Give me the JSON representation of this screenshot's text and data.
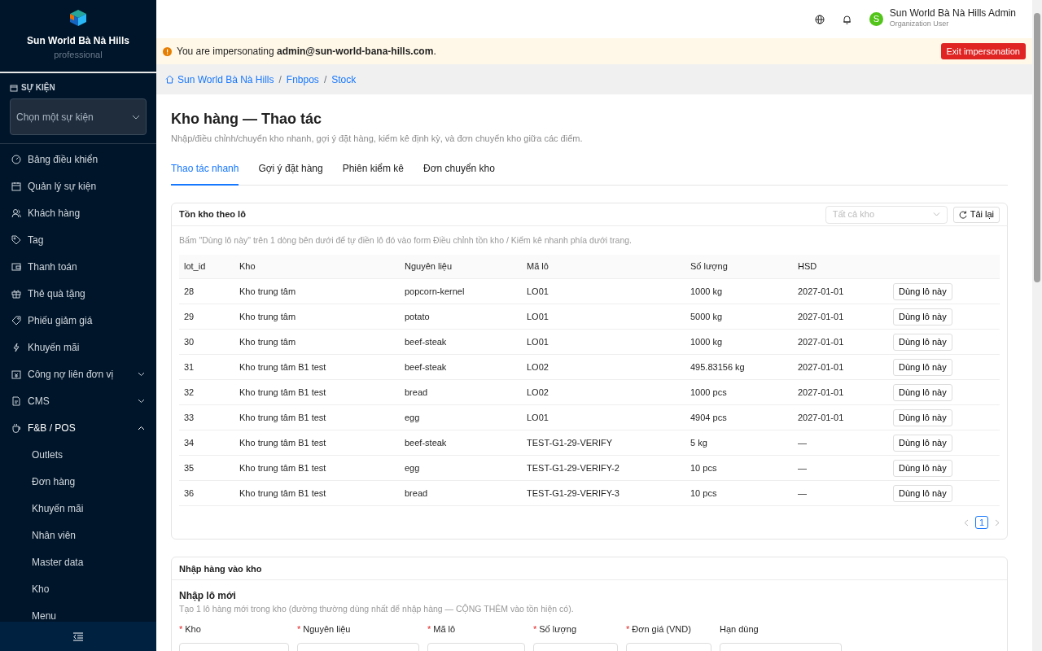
{
  "brand": {
    "name": "Sun World Bà Nà Hills",
    "plan": "professional"
  },
  "event_picker": {
    "label": "SỰ KIỆN",
    "placeholder": "Chọn một sự kiện"
  },
  "sidebar": {
    "items": [
      {
        "label": "Bảng điều khiển"
      },
      {
        "label": "Quản lý sự kiện"
      },
      {
        "label": "Khách hàng"
      },
      {
        "label": "Tag"
      },
      {
        "label": "Thanh toán"
      },
      {
        "label": "Thẻ quà tặng"
      },
      {
        "label": "Phiếu giảm giá"
      },
      {
        "label": "Khuyến mãi"
      },
      {
        "label": "Công nợ liên đơn vị",
        "expanded": false
      },
      {
        "label": "CMS",
        "expanded": false
      },
      {
        "label": "F&B / POS",
        "expanded": true,
        "children": [
          {
            "label": "Outlets"
          },
          {
            "label": "Đơn hàng"
          },
          {
            "label": "Khuyến mãi"
          },
          {
            "label": "Nhân viên"
          },
          {
            "label": "Master data"
          },
          {
            "label": "Kho"
          },
          {
            "label": "Menu"
          }
        ]
      }
    ]
  },
  "user": {
    "initial": "S",
    "name": "Sun World Bà Nà Hills Admin",
    "role": "Organization User"
  },
  "impersonation": {
    "text": "You are impersonating **admin@sun-world-bana-hills.com**.",
    "button": "Exit impersonation"
  },
  "breadcrumb": {
    "items": [
      "Sun World Bà Nà Hills",
      "Fnbpos",
      "Stock"
    ],
    "separator": "/"
  },
  "page": {
    "title": "Kho hàng — Thao tác",
    "subtitle": "Nhập/điều chỉnh/chuyển kho nhanh, gợi ý đặt hàng, kiểm kê định kỳ, và đơn chuyển kho giữa các điểm."
  },
  "tabs": [
    {
      "label": "Thao tác nhanh",
      "selected": true
    },
    {
      "label": "Gợi ý đặt hàng",
      "selected": false
    },
    {
      "label": "Phiên kiểm kê",
      "selected": false
    },
    {
      "label": "Đơn chuyển kho",
      "selected": false
    }
  ],
  "lots_card": {
    "title": "Tồn kho theo lô",
    "filter_placeholder": "Tất cả kho",
    "reload": "Tải lại",
    "hint": "Bấm \"Dùng lô này\" trên 1 dòng bên dưới để tự điền lô đó vào form Điều chỉnh tồn kho / Kiểm kê nhanh phía dưới trang.",
    "table": {
      "columns": [
        "lot_id",
        "Kho",
        "Nguyên liệu",
        "Mã lô",
        "Số lượng",
        "HSD"
      ],
      "rows": [
        {
          "cells": [
            "28",
            "Kho trung tâm",
            "popcorn-kernel",
            "LO01",
            "1000 kg",
            "2027-01-01"
          ],
          "action": "Dùng lô này"
        },
        {
          "cells": [
            "29",
            "Kho trung tâm",
            "potato",
            "LO01",
            "5000 kg",
            "2027-01-01"
          ],
          "action": "Dùng lô này"
        },
        {
          "cells": [
            "30",
            "Kho trung tâm",
            "beef-steak",
            "LO01",
            "1000 kg",
            "2027-01-01"
          ],
          "action": "Dùng lô này"
        },
        {
          "cells": [
            "31",
            "Kho trung tâm B1 test",
            "beef-steak",
            "LO02",
            "495.83156 kg",
            "2027-01-01"
          ],
          "action": "Dùng lô này"
        },
        {
          "cells": [
            "32",
            "Kho trung tâm B1 test",
            "bread",
            "LO02",
            "1000 pcs",
            "2027-01-01"
          ],
          "action": "Dùng lô này"
        },
        {
          "cells": [
            "33",
            "Kho trung tâm B1 test",
            "egg",
            "LO01",
            "4904 pcs",
            "2027-01-01"
          ],
          "action": "Dùng lô này"
        },
        {
          "cells": [
            "34",
            "Kho trung tâm B1 test",
            "beef-steak",
            "TEST-G1-29-VERIFY",
            "5 kg",
            "—"
          ],
          "action": "Dùng lô này"
        },
        {
          "cells": [
            "35",
            "Kho trung tâm B1 test",
            "egg",
            "TEST-G1-29-VERIFY-2",
            "10 pcs",
            "—"
          ],
          "action": "Dùng lô này"
        },
        {
          "cells": [
            "36",
            "Kho trung tâm B1 test",
            "bread",
            "TEST-G1-29-VERIFY-3",
            "10 pcs",
            "—"
          ],
          "action": "Dùng lô này"
        }
      ]
    },
    "pagination": {
      "pages": [
        {
          "label": "1",
          "selected": true
        }
      ]
    }
  },
  "import_card": {
    "title": "Nhập hàng vào kho",
    "section": "Nhập lô mới",
    "description": "Tạo 1 lô hàng mới trong kho (đường thường dùng nhất để nhập hàng — CỘNG THÊM vào tồn hiện có).",
    "required_mark": "*",
    "fields": [
      {
        "label": "Kho",
        "required": true
      },
      {
        "label": "Nguyên liệu",
        "required": true
      },
      {
        "label": "Mã lô",
        "required": true
      },
      {
        "label": "Số lượng",
        "required": true
      },
      {
        "label": "Đơn giá (VND)",
        "required": true
      },
      {
        "label": "Hạn dùng",
        "required": false
      }
    ]
  }
}
